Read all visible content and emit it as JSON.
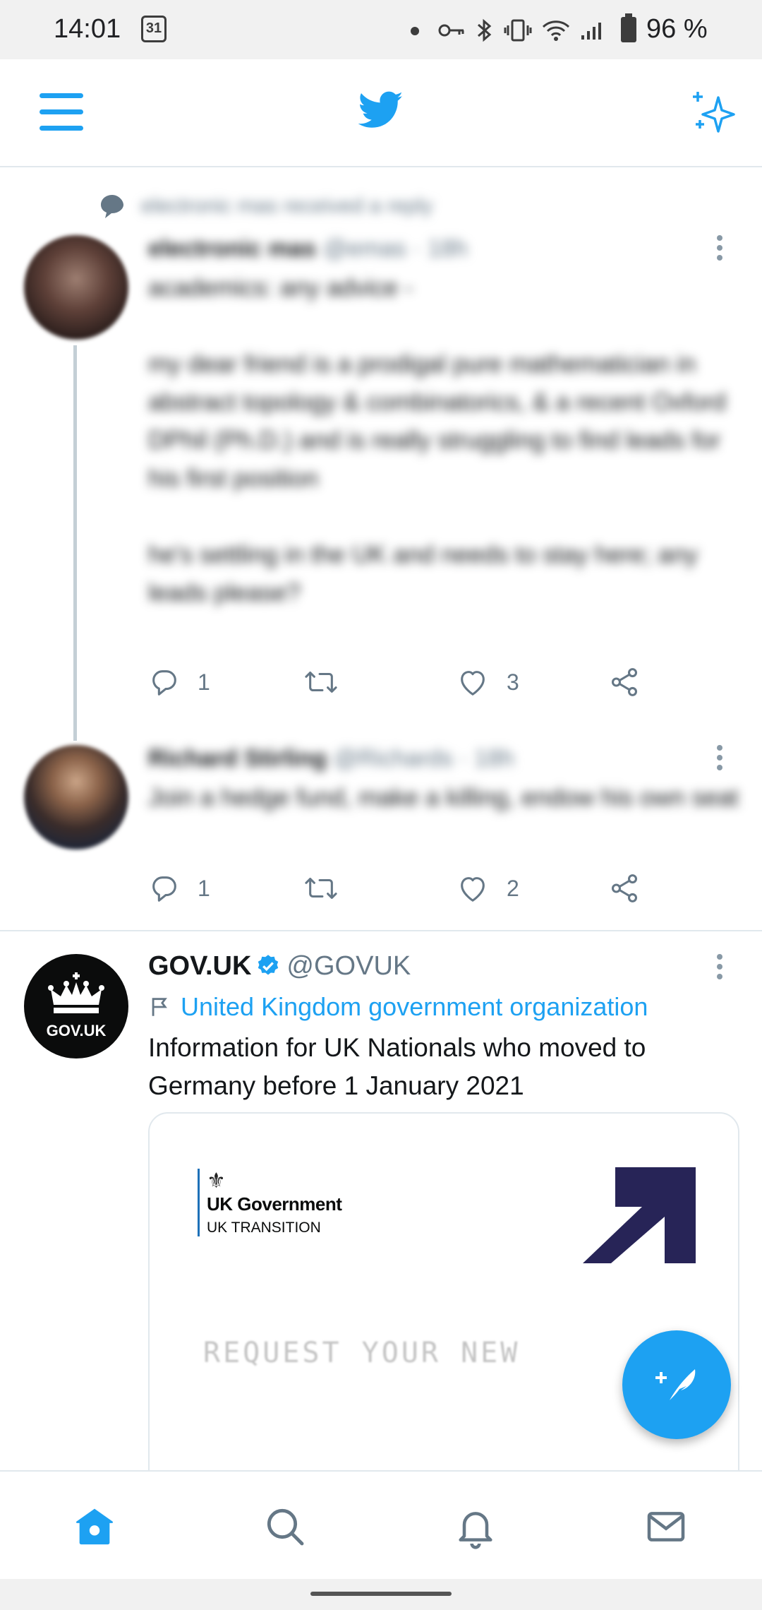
{
  "status_bar": {
    "time": "14:01",
    "calendar_day": "31",
    "battery": "96 %"
  },
  "header": {
    "menu_icon": "hamburger-icon",
    "logo_icon": "twitter-bird-icon",
    "sparkle_icon": "sparkle-icon"
  },
  "feed": {
    "thread": {
      "social_context": "electronic mas received a reply",
      "tweet": {
        "name": "electronic mas",
        "handle": "@emas · 18h",
        "paragraphs": [
          "academics: any advice -",
          "my dear friend is a prodigal pure mathematician in abstract topology & combinatorics, & a recent Oxford DPhil (Ph.D.) and is really struggling to find leads for his first position",
          "he's settling in the UK and needs to stay here; any leads please?"
        ],
        "replies": "1",
        "retweets": "",
        "likes": "3"
      },
      "reply": {
        "name": "Richard Stirling",
        "handle": "@Richards · 18h",
        "text": "Join a hedge fund, make a killing, endow his own seat",
        "replies": "1",
        "retweets": "",
        "likes": "2"
      }
    },
    "promoted": {
      "name": "GOV.UK",
      "handle": "@GOVUK",
      "avatar_text": "GOV.UK",
      "label": "United Kingdom government organization",
      "text": "Information for UK Nationals who moved to Germany before 1 January 2021",
      "card": {
        "logo_title": "UK Government",
        "logo_subtitle": "UK TRANSITION",
        "headline": "REQUEST YOUR NEW"
      }
    }
  },
  "compose_button": {
    "icon": "compose-feather-icon"
  },
  "bottom_nav": [
    {
      "name": "home",
      "icon": "home-icon",
      "active": true
    },
    {
      "name": "search",
      "icon": "search-icon",
      "active": false
    },
    {
      "name": "notifications",
      "icon": "bell-icon",
      "active": false
    },
    {
      "name": "messages",
      "icon": "mail-icon",
      "active": false
    }
  ],
  "colors": {
    "accent": "#1da1f2",
    "text": "#14171a",
    "muted": "#657786",
    "divider": "#e1e8ed",
    "gov_navy": "#272457"
  }
}
